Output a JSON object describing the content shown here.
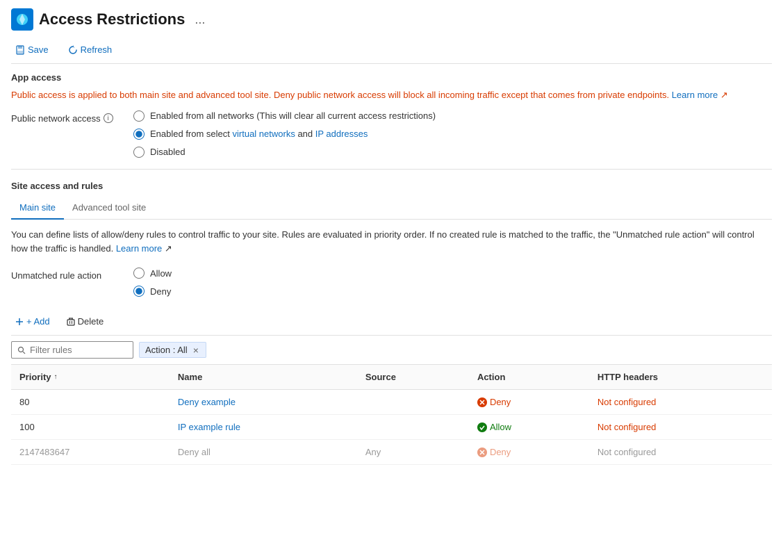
{
  "header": {
    "title": "Access Restrictions",
    "ellipsis": "..."
  },
  "toolbar": {
    "save_label": "Save",
    "refresh_label": "Refresh"
  },
  "app_access": {
    "section_title": "App access",
    "info_text": "Public access is applied to both main site and advanced tool site. Deny public network access will block all incoming traffic except that comes from private endpoints.",
    "learn_more_text": "Learn more",
    "public_network_label": "Public network access",
    "info_icon": "i",
    "options": [
      {
        "id": "opt1",
        "label_plain": "Enabled from all networks ",
        "label_paren": "(This will clear all current access restrictions)",
        "checked": false
      },
      {
        "id": "opt2",
        "label_pre": "Enabled from select ",
        "label_blue1": "virtual networks",
        "label_mid": " and ",
        "label_blue2": "IP addresses",
        "checked": true
      },
      {
        "id": "opt3",
        "label": "Disabled",
        "checked": false
      }
    ]
  },
  "site_access": {
    "section_title": "Site access and rules",
    "tabs": [
      {
        "id": "main-site",
        "label": "Main site",
        "active": true
      },
      {
        "id": "advanced-tool-site",
        "label": "Advanced tool site",
        "active": false
      }
    ],
    "description": "You can define lists of allow/deny rules to control traffic to your site. Rules are evaluated in priority order. If no created rule is matched to the traffic, the \"Unmatched rule action\" will control how the traffic is handled.",
    "learn_more_text": "Learn more",
    "unmatched_label": "Unmatched rule action",
    "unmatched_options": [
      {
        "id": "allow",
        "label": "Allow",
        "checked": false
      },
      {
        "id": "deny",
        "label": "Deny",
        "checked": true
      }
    ]
  },
  "table_toolbar": {
    "add_label": "+ Add",
    "delete_label": "Delete"
  },
  "filter": {
    "placeholder": "Filter rules",
    "tag_label": "Action : All",
    "tag_close": "×"
  },
  "table": {
    "columns": [
      {
        "key": "priority",
        "label": "Priority",
        "sortable": true,
        "sort_icon": "↑"
      },
      {
        "key": "name",
        "label": "Name"
      },
      {
        "key": "source",
        "label": "Source"
      },
      {
        "key": "action",
        "label": "Action"
      },
      {
        "key": "http_headers",
        "label": "HTTP headers"
      }
    ],
    "rows": [
      {
        "priority": "80",
        "name": "Deny example",
        "source": "",
        "action": "Deny",
        "action_type": "deny",
        "http_headers": "Not configured"
      },
      {
        "priority": "100",
        "name": "IP example rule",
        "source": "",
        "action": "Allow",
        "action_type": "allow",
        "http_headers": "Not configured"
      },
      {
        "priority": "2147483647",
        "name": "Deny all",
        "source": "Any",
        "action": "Deny",
        "action_type": "deny",
        "http_headers": "Not configured",
        "muted": true
      }
    ]
  }
}
